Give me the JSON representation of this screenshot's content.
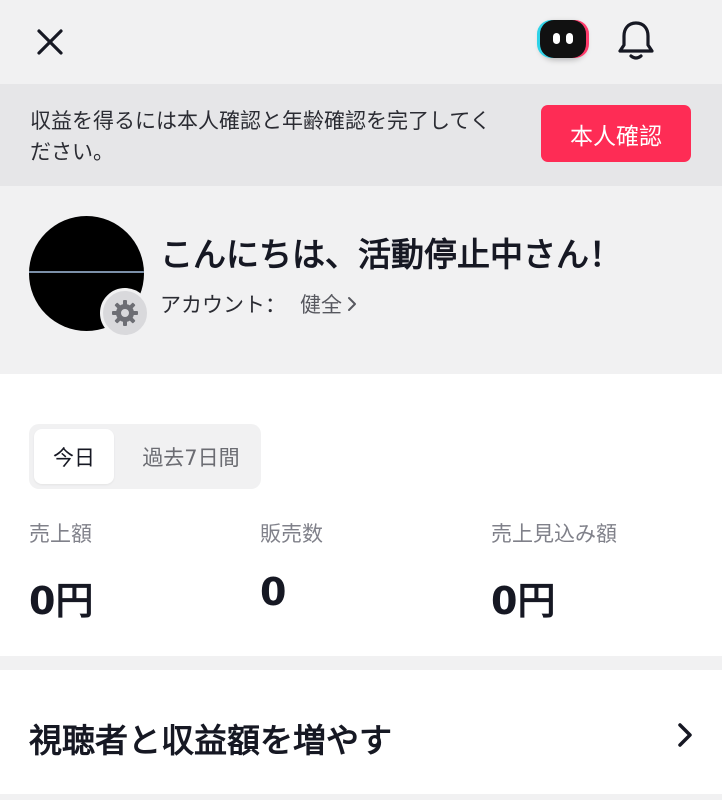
{
  "header": {
    "close_icon": "close-icon",
    "bot_icon": "assistant-bot-icon",
    "bell_icon": "bell-icon"
  },
  "banner": {
    "text": "収益を得るには本人確認と年齢確認を完了してください。",
    "button_label": "本人確認",
    "button_color": "#fe2c55"
  },
  "profile": {
    "greeting": "こんにちは、活動停止中さん！",
    "account_label": "アカウント：",
    "account_status": "健全",
    "settings_icon": "gear-icon"
  },
  "stats": {
    "tabs": [
      {
        "label": "今日",
        "selected": true
      },
      {
        "label": "過去7日間",
        "selected": false
      }
    ],
    "metrics": [
      {
        "label": "売上額",
        "value": "0円"
      },
      {
        "label": "販売数",
        "value": "0"
      },
      {
        "label": "売上見込み額",
        "value": "0円"
      }
    ]
  },
  "promo": {
    "title": "視聴者と収益額を増やす",
    "chevron_icon": "chevron-right-icon"
  }
}
